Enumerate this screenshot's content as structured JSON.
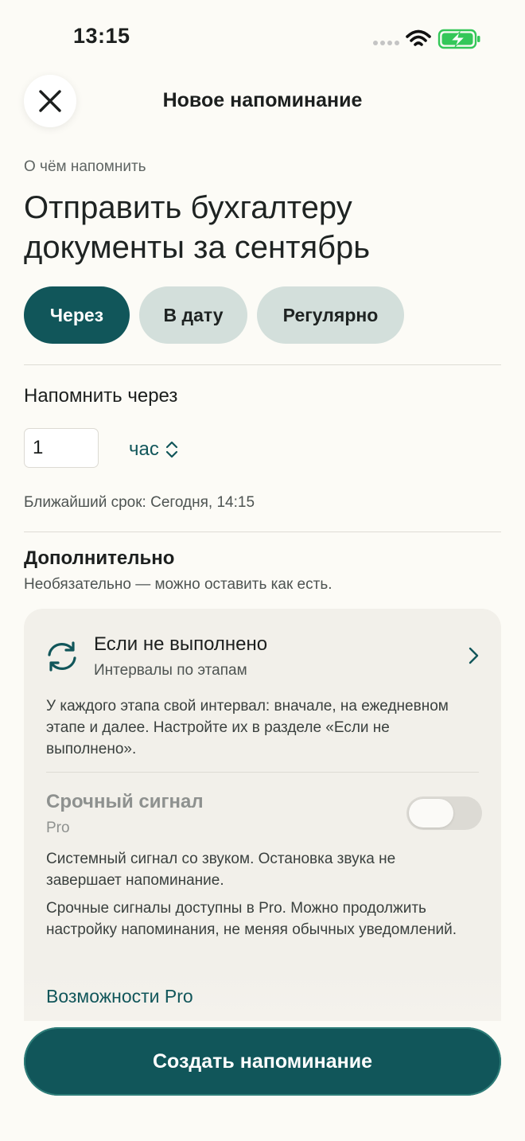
{
  "status_bar": {
    "time": "13:15",
    "icons": [
      "signal-icon",
      "wifi-icon",
      "battery-charging-icon"
    ]
  },
  "header": {
    "title": "Новое напоминание",
    "close_icon": "close-icon"
  },
  "what": {
    "label": "О чём напомнить",
    "text": "Отправить бухгалтеру документы за сентябрь"
  },
  "mode_tabs": [
    {
      "label": "Через",
      "selected": true
    },
    {
      "label": "В дату",
      "selected": false
    },
    {
      "label": "Регулярно",
      "selected": false
    }
  ],
  "remind_in": {
    "label": "Напомнить через",
    "amount": "1",
    "unit": "час"
  },
  "deadline": "Ближайший срок: Сегодня, 14:15",
  "extra": {
    "title": "Дополнительно",
    "subtitle": "Необязательно — можно оставить как есть.",
    "if_not_done": {
      "title": "Если не выполнено",
      "subtitle": "Интервалы по этапам",
      "description": "У каждого этапа свой интервал: вначале, на ежедневном этапе и далее. Настройте их в разделе «Если не выполнено»."
    },
    "urgent": {
      "title": "Срочный сигнал",
      "badge": "Pro",
      "enabled": false,
      "description": "Системный сигнал со звуком. Остановка звука не завершает напоминание.",
      "pro_note": "Срочные сигналы доступны в Pro. Можно продолжить настройку напоминания, не меняя обычных уведомлений."
    },
    "pro_link": "Возможности Pro"
  },
  "create_button": "Создать напоминание",
  "colors": {
    "accent": "#11565a",
    "background": "#fcfbf6",
    "chip": "#d3dfdb",
    "card": "#f2f0ea"
  }
}
